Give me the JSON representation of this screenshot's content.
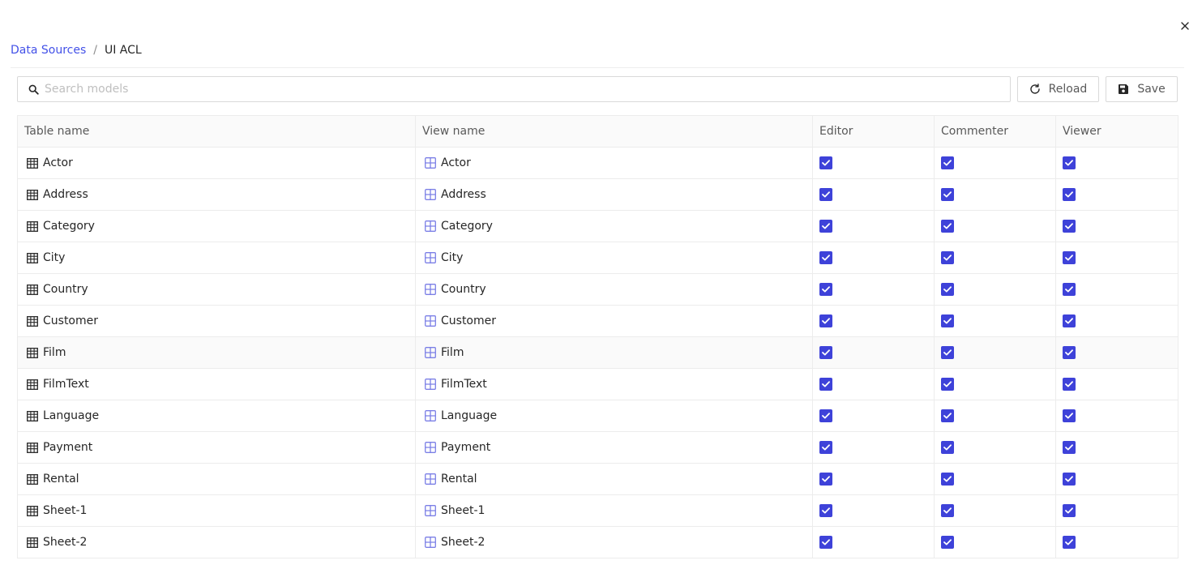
{
  "breadcrumb": {
    "link": "Data Sources",
    "separator": "/",
    "current": "UI ACL"
  },
  "toolbar": {
    "search_placeholder": "Search models",
    "reload_label": "Reload",
    "save_label": "Save"
  },
  "colors": {
    "accent": "#4351e8",
    "checkbox": "#3e42d9",
    "view_icon": "#7b7fe6"
  },
  "table": {
    "headers": [
      "Table name",
      "View name",
      "Editor",
      "Commenter",
      "Viewer"
    ],
    "rows": [
      {
        "table": "Actor",
        "view": "Actor",
        "editor": true,
        "commenter": true,
        "viewer": true
      },
      {
        "table": "Address",
        "view": "Address",
        "editor": true,
        "commenter": true,
        "viewer": true
      },
      {
        "table": "Category",
        "view": "Category",
        "editor": true,
        "commenter": true,
        "viewer": true
      },
      {
        "table": "City",
        "view": "City",
        "editor": true,
        "commenter": true,
        "viewer": true
      },
      {
        "table": "Country",
        "view": "Country",
        "editor": true,
        "commenter": true,
        "viewer": true
      },
      {
        "table": "Customer",
        "view": "Customer",
        "editor": true,
        "commenter": true,
        "viewer": true
      },
      {
        "table": "Film",
        "view": "Film",
        "editor": true,
        "commenter": true,
        "viewer": true
      },
      {
        "table": "FilmText",
        "view": "FilmText",
        "editor": true,
        "commenter": true,
        "viewer": true
      },
      {
        "table": "Language",
        "view": "Language",
        "editor": true,
        "commenter": true,
        "viewer": true
      },
      {
        "table": "Payment",
        "view": "Payment",
        "editor": true,
        "commenter": true,
        "viewer": true
      },
      {
        "table": "Rental",
        "view": "Rental",
        "editor": true,
        "commenter": true,
        "viewer": true
      },
      {
        "table": "Sheet-1",
        "view": "Sheet-1",
        "editor": true,
        "commenter": true,
        "viewer": true
      },
      {
        "table": "Sheet-2",
        "view": "Sheet-2",
        "editor": true,
        "commenter": true,
        "viewer": true
      }
    ]
  }
}
